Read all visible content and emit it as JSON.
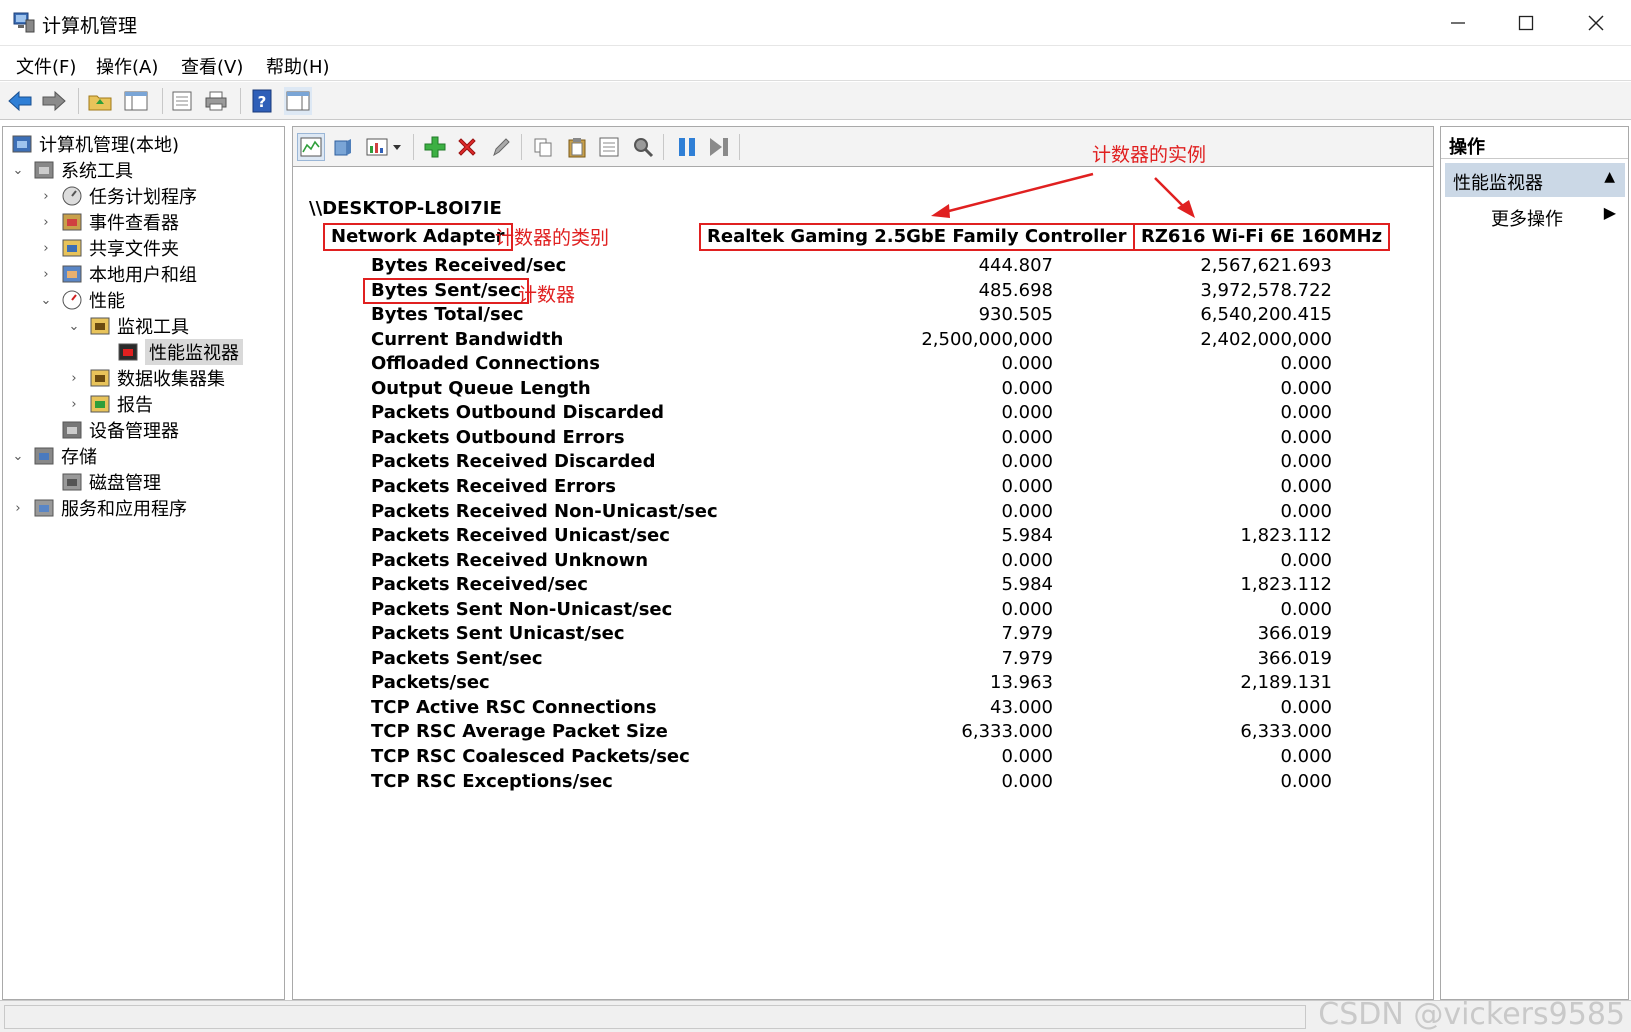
{
  "window": {
    "title": "计算机管理",
    "minimize_icon": "minimize-icon",
    "maximize_icon": "maximize-icon",
    "close_icon": "close-icon"
  },
  "menu": {
    "items": [
      "文件(F)",
      "操作(A)",
      "查看(V)",
      "帮助(H)"
    ]
  },
  "tree": {
    "items": [
      {
        "label": "计算机管理(本地)",
        "icon": "computer-management-icon",
        "expand": ""
      },
      {
        "label": "系统工具",
        "icon": "tools-icon",
        "expand": "expanded"
      },
      {
        "label": "任务计划程序",
        "icon": "clock-icon",
        "expand": "collapsed"
      },
      {
        "label": "事件查看器",
        "icon": "event-viewer-icon",
        "expand": "collapsed"
      },
      {
        "label": "共享文件夹",
        "icon": "shared-folder-icon",
        "expand": "collapsed"
      },
      {
        "label": "本地用户和组",
        "icon": "users-icon",
        "expand": "collapsed"
      },
      {
        "label": "性能",
        "icon": "performance-icon",
        "expand": "expanded"
      },
      {
        "label": "监视工具",
        "icon": "folder-icon",
        "expand": "expanded"
      },
      {
        "label": "性能监视器",
        "icon": "perfmon-icon",
        "expand": ""
      },
      {
        "label": "数据收集器集",
        "icon": "folder-icon",
        "expand": "collapsed"
      },
      {
        "label": "报告",
        "icon": "report-icon",
        "expand": "collapsed"
      },
      {
        "label": "设备管理器",
        "icon": "device-manager-icon",
        "expand": ""
      },
      {
        "label": "存储",
        "icon": "storage-icon",
        "expand": "expanded"
      },
      {
        "label": "磁盘管理",
        "icon": "disk-icon",
        "expand": ""
      },
      {
        "label": "服务和应用程序",
        "icon": "services-icon",
        "expand": "collapsed"
      }
    ]
  },
  "report": {
    "machine": "\\\\DESKTOP-L8OI7IE",
    "category": "Network Adapter",
    "instances": [
      "Realtek Gaming 2.5GbE Family Controller",
      "RZ616 Wi-Fi 6E 160MHz"
    ],
    "annotations": {
      "category_note": "计数器的类别",
      "counter_note": "计数器",
      "instance_note": "计数器的实例"
    },
    "counters": [
      {
        "name": "Bytes Received/sec",
        "v1": "444.807",
        "v2": "2,567,621.693"
      },
      {
        "name": "Bytes Sent/sec",
        "v1": "485.698",
        "v2": "3,972,578.722"
      },
      {
        "name": "Bytes Total/sec",
        "v1": "930.505",
        "v2": "6,540,200.415"
      },
      {
        "name": "Current Bandwidth",
        "v1": "2,500,000,000",
        "v2": "2,402,000,000"
      },
      {
        "name": "Offloaded Connections",
        "v1": "0.000",
        "v2": "0.000"
      },
      {
        "name": "Output Queue Length",
        "v1": "0.000",
        "v2": "0.000"
      },
      {
        "name": "Packets Outbound Discarded",
        "v1": "0.000",
        "v2": "0.000"
      },
      {
        "name": "Packets Outbound Errors",
        "v1": "0.000",
        "v2": "0.000"
      },
      {
        "name": "Packets Received Discarded",
        "v1": "0.000",
        "v2": "0.000"
      },
      {
        "name": "Packets Received Errors",
        "v1": "0.000",
        "v2": "0.000"
      },
      {
        "name": "Packets Received Non-Unicast/sec",
        "v1": "0.000",
        "v2": "0.000"
      },
      {
        "name": "Packets Received Unicast/sec",
        "v1": "5.984",
        "v2": "1,823.112"
      },
      {
        "name": "Packets Received Unknown",
        "v1": "0.000",
        "v2": "0.000"
      },
      {
        "name": "Packets Received/sec",
        "v1": "5.984",
        "v2": "1,823.112"
      },
      {
        "name": "Packets Sent Non-Unicast/sec",
        "v1": "0.000",
        "v2": "0.000"
      },
      {
        "name": "Packets Sent Unicast/sec",
        "v1": "7.979",
        "v2": "366.019"
      },
      {
        "name": "Packets Sent/sec",
        "v1": "7.979",
        "v2": "366.019"
      },
      {
        "name": "Packets/sec",
        "v1": "13.963",
        "v2": "2,189.131"
      },
      {
        "name": "TCP Active RSC Connections",
        "v1": "43.000",
        "v2": "0.000"
      },
      {
        "name": "TCP RSC Average Packet Size",
        "v1": "6,333.000",
        "v2": "6,333.000"
      },
      {
        "name": "TCP RSC Coalesced Packets/sec",
        "v1": "0.000",
        "v2": "0.000"
      },
      {
        "name": "TCP RSC Exceptions/sec",
        "v1": "0.000",
        "v2": "0.000"
      }
    ]
  },
  "actions": {
    "header": "操作",
    "section": "性能监视器",
    "more": "更多操作"
  },
  "watermark": "CSDN @vickers9585",
  "colors": {
    "annotation_red": "#e02020",
    "section_blue": "#cbd8e6"
  }
}
